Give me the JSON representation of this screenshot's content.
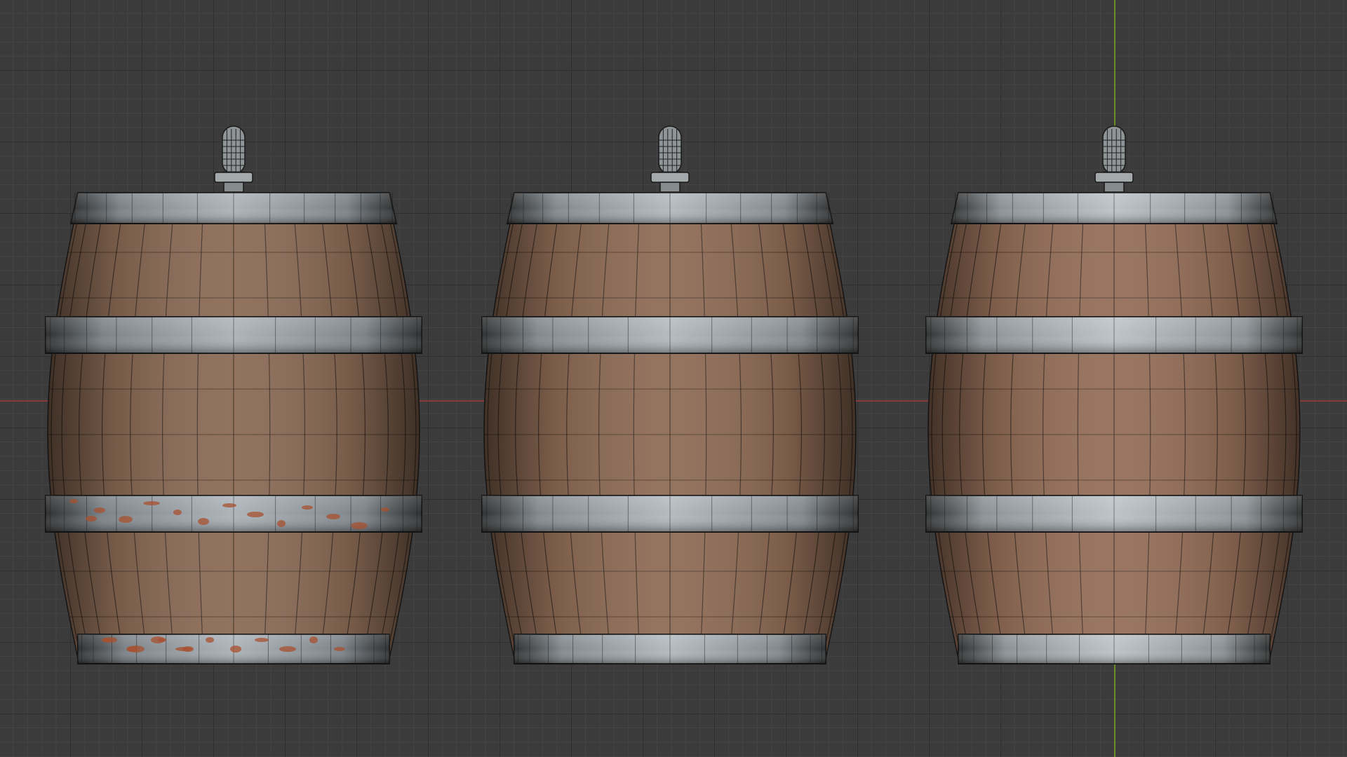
{
  "viewport": {
    "background_color": "#3b3b3b",
    "x_axis_color": "#8a3a3e",
    "y_axis_color": "#6b8e23",
    "grid_major_color": "#2e2e2e",
    "grid_minor_color": "#444444"
  },
  "barrels": [
    {
      "id": "barrel-rusty",
      "variant": "rusty-weathered",
      "wood_color": "#8a6a55",
      "hoop_color": "#9aa3aa",
      "rust": true,
      "wear": "high"
    },
    {
      "id": "barrel-weathered",
      "variant": "weathered",
      "wood_color": "#8e6b55",
      "hoop_color": "#a3acb2",
      "rust": false,
      "wear": "medium"
    },
    {
      "id": "barrel-clean",
      "variant": "clean",
      "wood_color": "#946e58",
      "hoop_color": "#aeb6bb",
      "rust": false,
      "wear": "low"
    }
  ],
  "icons": {
    "spigot": "spigot-icon",
    "hoop": "metal-hoop",
    "stave": "wood-stave"
  }
}
